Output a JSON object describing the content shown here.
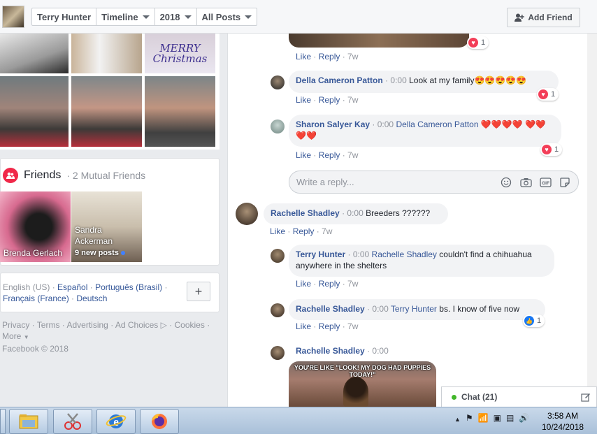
{
  "topbar": {
    "crumbs": [
      "Terry Hunter",
      "Timeline",
      "2018",
      "All Posts"
    ],
    "add_friend": "Add Friend"
  },
  "photos": {
    "christmas_text": "MERRY Christmas"
  },
  "friends": {
    "title": "Friends",
    "subtitle": "· 2 Mutual Friends",
    "tiles": [
      {
        "name": "Brenda Gerlach"
      },
      {
        "name": "Sandra Ackerman",
        "sub": "9 new posts"
      }
    ]
  },
  "languages": {
    "current": "English (US)",
    "links": [
      "Español",
      "Português (Brasil)",
      "Français (France)",
      "Deutsch"
    ],
    "plus": "+"
  },
  "footer": {
    "links": [
      "Privacy",
      "Terms",
      "Advertising",
      "Ad Choices",
      "Cookies",
      "More"
    ],
    "copyright": "Facebook © 2018"
  },
  "comments": {
    "top_actions": {
      "like": "Like",
      "reply": "Reply",
      "age": "7w",
      "reactions": "1"
    },
    "items": [
      {
        "author": "Della Cameron Patton",
        "time": "0:00",
        "text": "Look at my family😍😍😍😍😍",
        "like": "Like",
        "reply": "Reply",
        "age": "7w",
        "reactions": "1"
      },
      {
        "author": "Sharon Salyer Kay",
        "time": "0:00",
        "mention": "Della Cameron Patton",
        "text": "❤️❤️❤️❤️ ❤️❤️❤️❤️",
        "like": "Like",
        "reply": "Reply",
        "age": "7w",
        "reactions": "1"
      },
      {
        "author": "Rachelle Shadley",
        "time": "0:00",
        "text": "Breeders ??????",
        "like": "Like",
        "reply": "Reply",
        "age": "7w"
      },
      {
        "author": "Terry Hunter",
        "time": "0:00",
        "mention": "Rachelle Shadley",
        "text": "couldn't find a chihuahua anywhere in the shelters",
        "like": "Like",
        "reply": "Reply",
        "age": "7w"
      },
      {
        "author": "Rachelle Shadley",
        "time": "0:00",
        "mention": "Terry Hunter",
        "text": "bs. I know of five now",
        "like": "Like",
        "reply": "Reply",
        "age": "7w",
        "reactions": "1"
      },
      {
        "author": "Rachelle Shadley",
        "time": "0:00",
        "meme_text": "YOU'RE LIKE \"LOOK! MY DOG HAD PUPPIES TODAY!\""
      }
    ],
    "reply_placeholder": "Write a reply..."
  },
  "chat": {
    "label": "Chat (21)"
  },
  "taskbar": {
    "time": "3:58 AM",
    "date": "10/24/2018"
  },
  "colors": {
    "link": "#385898",
    "heart": "#f33e58",
    "like": "#1877f2"
  }
}
